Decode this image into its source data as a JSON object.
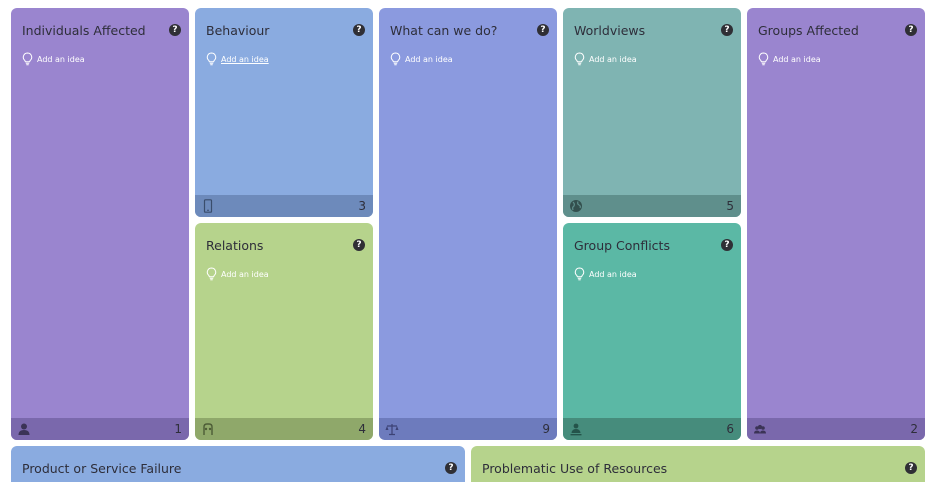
{
  "add_idea_label": "Add an idea",
  "cards": {
    "individuals": {
      "title": "Individuals Affected",
      "count": "1",
      "icon": "person-icon"
    },
    "behaviour": {
      "title": "Behaviour",
      "count": "3",
      "icon": "phone-icon"
    },
    "relations": {
      "title": "Relations",
      "count": "4",
      "icon": "relations-icon"
    },
    "what_can_we_do": {
      "title": "What can we do?",
      "count": "9",
      "icon": "scales-icon"
    },
    "worldviews": {
      "title": "Worldviews",
      "count": "5",
      "icon": "globe-icon"
    },
    "group_conflicts": {
      "title": "Group Conflicts",
      "count": "6",
      "icon": "conflict-icon"
    },
    "groups_affected": {
      "title": "Groups Affected",
      "count": "2",
      "icon": "group-icon"
    },
    "product_failure": {
      "title": "Product or Service Failure"
    },
    "problematic_resources": {
      "title": "Problematic Use of Resources"
    }
  },
  "colors": {
    "purple": "#9a85cf",
    "blue": "#8aabe0",
    "periwinkle": "#8b9adf",
    "slate": "#7fb4b2",
    "green": "#b6d38c",
    "teal": "#5bb8a5"
  }
}
